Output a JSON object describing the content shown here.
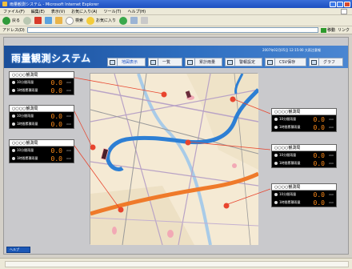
{
  "browser": {
    "title": "雨量観測システム - Microsoft Internet Explorer",
    "menu": [
      "ファイル(F)",
      "編集(E)",
      "表示(V)",
      "お気に入り(A)",
      "ツール(T)",
      "ヘルプ(H)"
    ],
    "toolbar": {
      "back": "戻る",
      "search": "検索",
      "favorites": "お気に入り"
    },
    "address_label": "アドレス(D)",
    "address_value": "",
    "go_label": "移動",
    "links_label": "リンク"
  },
  "app": {
    "title": "雨量観測システム",
    "datetime": "2007年02月05日 12:15:00 大雨注意報",
    "nav": [
      "地図表示",
      "一覧",
      "累計雨量",
      "警報設定",
      "CSV保存",
      "グラフ"
    ],
    "help": "ヘルプ"
  },
  "panels": {
    "left": [
      {
        "name": "○○○○観測局",
        "r1_label": "10分間雨量",
        "r1_val": "0.0",
        "r2_label": "1時間累積雨量",
        "r2_val": "0.0",
        "unit": "mm"
      },
      {
        "name": "○○○○観測局",
        "r1_label": "10分間雨量",
        "r1_val": "0.0",
        "r2_label": "1時間累積雨量",
        "r2_val": "0.0",
        "unit": "mm"
      },
      {
        "name": "○○○○観測局",
        "r1_label": "10分間雨量",
        "r1_val": "0.0",
        "r2_label": "1時間累積雨量",
        "r2_val": "0.0",
        "unit": "mm"
      }
    ],
    "right": [
      {
        "name": "○○○○観測局",
        "r1_label": "10分間雨量",
        "r1_val": "0.0",
        "r2_label": "1時間累積雨量",
        "r2_val": "0.0",
        "unit": "mm"
      },
      {
        "name": "○○○○観測局",
        "r1_label": "10分間雨量",
        "r1_val": "0.0",
        "r2_label": "1時間累積雨量",
        "r2_val": "0.0",
        "unit": "mm"
      },
      {
        "name": "○○○○観測局",
        "r1_label": "10分間雨量",
        "r1_val": "0.0",
        "r2_label": "1時間累積雨量",
        "r2_val": "0.0",
        "unit": "mm"
      }
    ]
  },
  "colors": {
    "banner": "#1b4f9a",
    "value": "#ff8c1a",
    "station_dot": "#e8452e",
    "river": "#3a86d8",
    "highway": "#ef7a2a"
  }
}
